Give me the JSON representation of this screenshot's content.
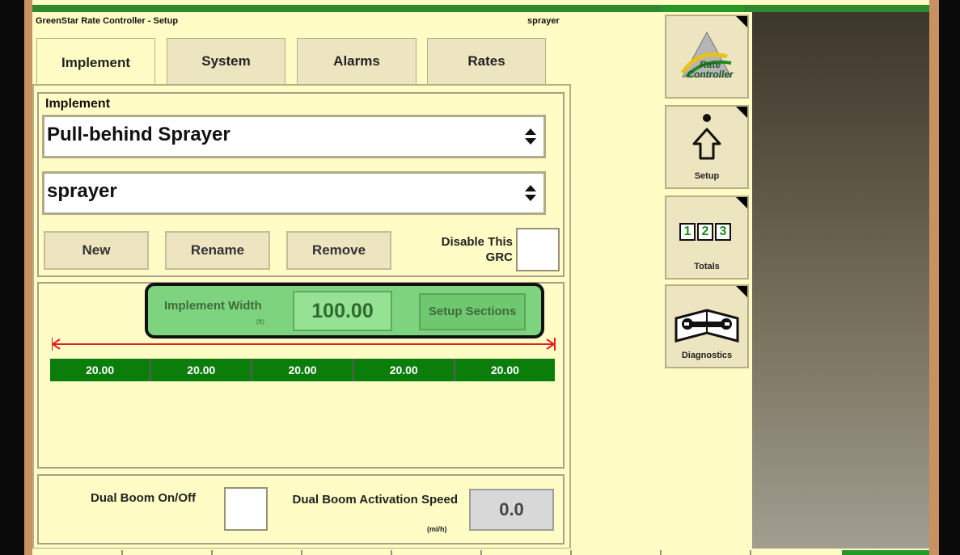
{
  "header": {
    "title": "GreenStar Rate Controller - Setup",
    "profile": "sprayer"
  },
  "tabs": [
    {
      "label": "Implement",
      "active": true
    },
    {
      "label": "System",
      "active": false
    },
    {
      "label": "Alarms",
      "active": false
    },
    {
      "label": "Rates",
      "active": false
    }
  ],
  "implement": {
    "section_label": "Implement",
    "type_value": "Pull-behind Sprayer",
    "name_value": "sprayer",
    "new_label": "New",
    "rename_label": "Rename",
    "remove_label": "Remove",
    "disable_label": "Disable This GRC",
    "disable_checked": false
  },
  "width": {
    "label": "Implement Width",
    "unit": "(ft)",
    "value": "100.00",
    "setup_sections_label": "Setup Sections"
  },
  "sections": [
    "20.00",
    "20.00",
    "20.00",
    "20.00",
    "20.00"
  ],
  "dual_boom": {
    "onoff_label": "Dual Boom On/Off",
    "onoff_checked": false,
    "speed_label": "Dual Boom Activation Speed",
    "speed_unit": "(mi/h)",
    "speed_value": "0.0"
  },
  "side_buttons": {
    "rate_controller_text": "Rate Controller",
    "setup_label": "Setup",
    "totals_digits": [
      "1",
      "2",
      "3"
    ],
    "totals_label": "Totals",
    "diagnostics_label": "Diagnostics"
  },
  "colors": {
    "background": "#fffcc5",
    "accent_green": "#279727",
    "section_green": "#0b7d0b",
    "highlight_green": "#7ed47e"
  }
}
